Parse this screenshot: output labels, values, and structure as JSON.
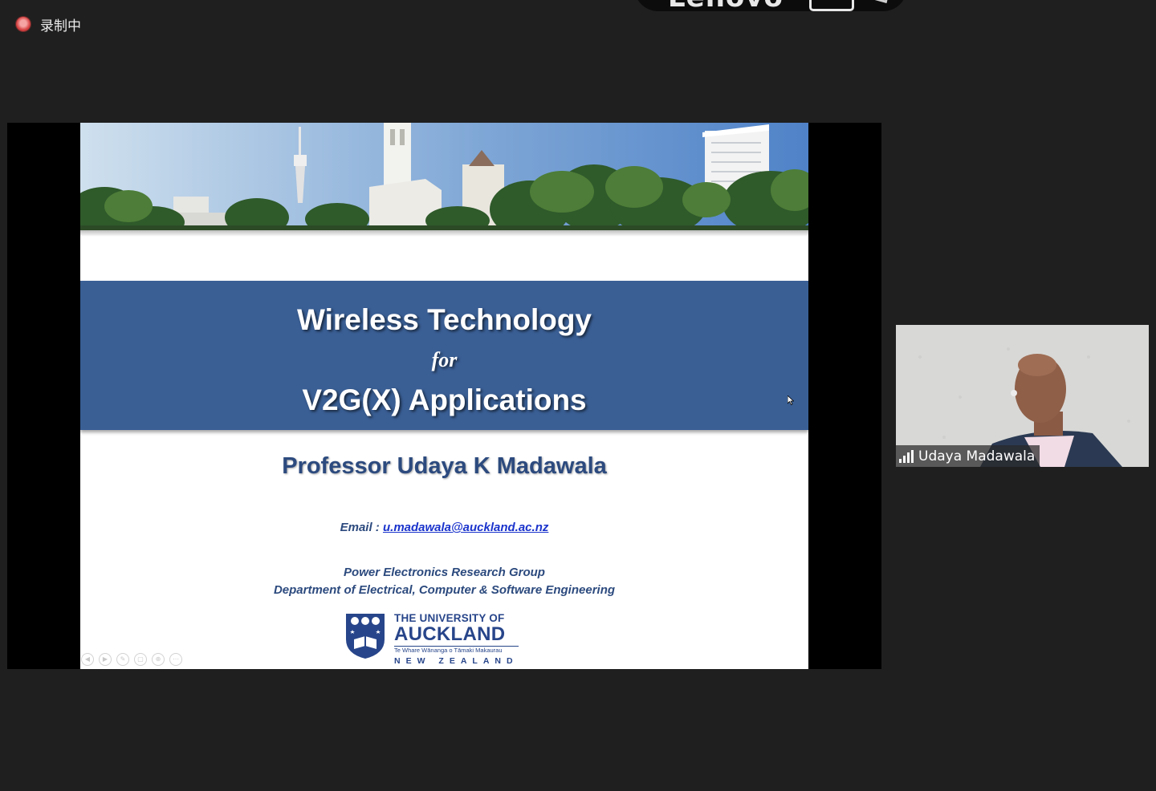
{
  "recording": {
    "label": "录制中"
  },
  "top_banner": {
    "brand": "Lenovo"
  },
  "slide": {
    "title_line1": "Wireless Technology",
    "title_line2": "for",
    "title_line3": "V2G(X) Applications",
    "presenter": "Professor Udaya K Madawala",
    "email_label": "Email : ",
    "email": "u.madawala@auckland.ac.nz",
    "group": "Power Electronics Research Group",
    "department": "Department of Electrical, Computer & Software Engineering",
    "logo": {
      "line1": "THE UNIVERSITY OF",
      "line2": "AUCKLAND",
      "line3": "Te Whare Wānanga o Tāmaki Makaurau",
      "line4": "NEW ZEALAND"
    }
  },
  "participant": {
    "name": "Udaya Madawala"
  },
  "icons": {
    "recording": "record-dot-icon",
    "signal": "signal-bars-icon",
    "cursor": "mouse-cursor-icon",
    "slide_controls": [
      "prev-icon",
      "next-icon",
      "pen-icon",
      "slides-icon",
      "zoom-icon",
      "more-icon"
    ]
  },
  "colors": {
    "background": "#1f1f1f",
    "title_band": "#3a5f95",
    "navy_text": "#2c4a7e",
    "link": "#1a33cc"
  }
}
